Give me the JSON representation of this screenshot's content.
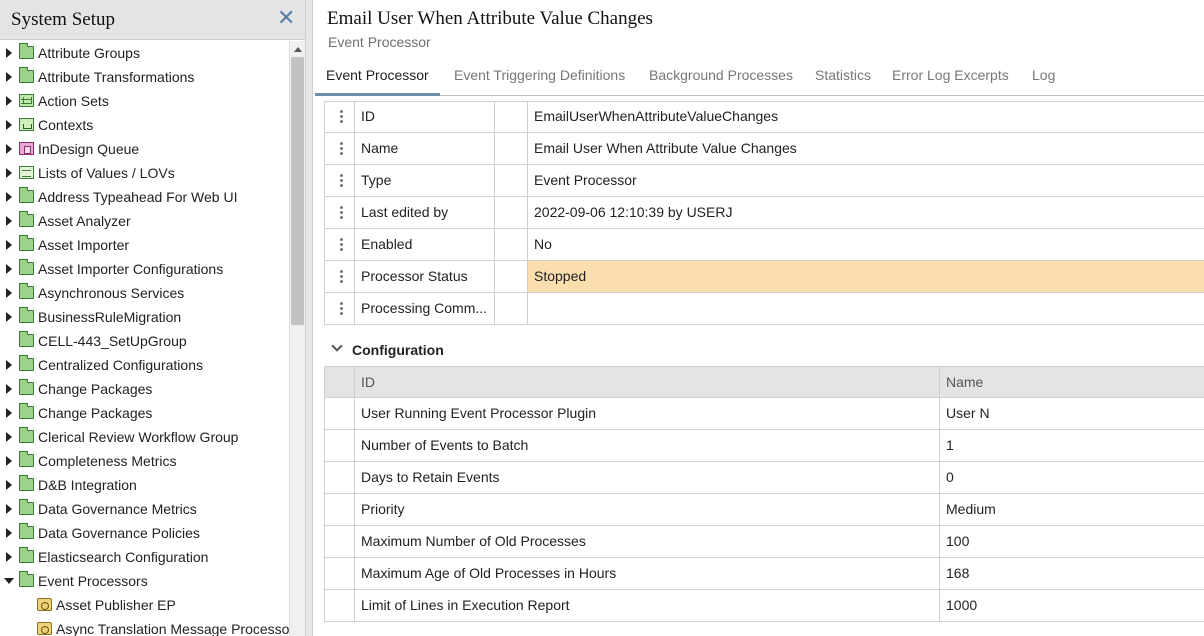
{
  "left_panel": {
    "title": "System Setup",
    "close_symbol": "✕",
    "tree": [
      {
        "label": "Attribute Groups",
        "icon": "folder-icon",
        "arrow": "right",
        "indent": 0
      },
      {
        "label": "Attribute Transformations",
        "icon": "folder-icon",
        "arrow": "right",
        "indent": 0
      },
      {
        "label": "Action Sets",
        "icon": "grid-icon",
        "arrow": "right",
        "indent": 0
      },
      {
        "label": "Contexts",
        "icon": "context-icon",
        "arrow": "right",
        "indent": 0
      },
      {
        "label": "InDesign Queue",
        "icon": "queue-icon",
        "arrow": "right",
        "indent": 0
      },
      {
        "label": "Lists of Values / LOVs",
        "icon": "list-icon",
        "arrow": "right",
        "indent": 0
      },
      {
        "label": "Address Typeahead For Web UI",
        "icon": "folder-icon",
        "arrow": "right",
        "indent": 0
      },
      {
        "label": "Asset Analyzer",
        "icon": "folder-icon",
        "arrow": "right",
        "indent": 0
      },
      {
        "label": "Asset Importer",
        "icon": "folder-icon",
        "arrow": "right",
        "indent": 0
      },
      {
        "label": "Asset Importer Configurations",
        "icon": "folder-icon",
        "arrow": "right",
        "indent": 0
      },
      {
        "label": "Asynchronous Services",
        "icon": "folder-icon",
        "arrow": "right",
        "indent": 0
      },
      {
        "label": "BusinessRuleMigration",
        "icon": "folder-icon",
        "arrow": "right",
        "indent": 0
      },
      {
        "label": "CELL-443_SetUpGroup",
        "icon": "folder-icon",
        "arrow": "none",
        "indent": 0
      },
      {
        "label": "Centralized Configurations",
        "icon": "folder-icon",
        "arrow": "right",
        "indent": 0
      },
      {
        "label": "Change Packages",
        "icon": "folder-icon",
        "arrow": "right",
        "indent": 0
      },
      {
        "label": "Change Packages",
        "icon": "folder-icon",
        "arrow": "right",
        "indent": 0
      },
      {
        "label": "Clerical Review Workflow Group",
        "icon": "folder-icon",
        "arrow": "right",
        "indent": 0
      },
      {
        "label": "Completeness Metrics",
        "icon": "folder-icon",
        "arrow": "right",
        "indent": 0
      },
      {
        "label": "D&B Integration",
        "icon": "folder-icon",
        "arrow": "right",
        "indent": 0
      },
      {
        "label": "Data Governance Metrics",
        "icon": "folder-icon",
        "arrow": "right",
        "indent": 0
      },
      {
        "label": "Data Governance Policies",
        "icon": "folder-icon",
        "arrow": "right",
        "indent": 0
      },
      {
        "label": "Elasticsearch Configuration",
        "icon": "folder-icon",
        "arrow": "right",
        "indent": 0
      },
      {
        "label": "Event Processors",
        "icon": "folder-icon",
        "arrow": "down",
        "indent": 0
      },
      {
        "label": "Asset Publisher EP",
        "icon": "ep-icon",
        "arrow": "none",
        "indent": 1
      },
      {
        "label": "Async Translation Message Processor",
        "icon": "ep-icon",
        "arrow": "none",
        "indent": 1
      }
    ]
  },
  "main": {
    "title": "Email User When Attribute Value Changes",
    "subtitle": "Event Processor",
    "tabs": [
      {
        "label": "Event Processor",
        "active": true
      },
      {
        "label": "Event Triggering Definitions",
        "active": false
      },
      {
        "label": "Background Processes",
        "active": false
      },
      {
        "label": "Statistics",
        "active": false
      },
      {
        "label": "Error Log Excerpts",
        "active": false
      },
      {
        "label": "Log",
        "active": false
      }
    ],
    "properties": [
      {
        "label": "ID",
        "value": "EmailUserWhenAttributeValueChanges",
        "highlight": false
      },
      {
        "label": "Name",
        "value": "Email User When Attribute Value Changes",
        "highlight": false
      },
      {
        "label": "Type",
        "value": "Event Processor",
        "highlight": false
      },
      {
        "label": "Last edited by",
        "value": "2022-09-06 12:10:39 by USERJ",
        "highlight": false
      },
      {
        "label": "Enabled",
        "value": "No",
        "highlight": false
      },
      {
        "label": "Processor Status",
        "value": "Stopped",
        "highlight": true
      },
      {
        "label": "Processing Comm...",
        "value": "",
        "highlight": false
      }
    ],
    "configuration": {
      "title": "Configuration",
      "columns": {
        "id": "ID",
        "name": "Name"
      },
      "rows": [
        {
          "id": "User Running Event Processor Plugin",
          "name": "User N"
        },
        {
          "id": "Number of Events to Batch",
          "name": "1"
        },
        {
          "id": "Days to Retain Events",
          "name": "0"
        },
        {
          "id": "Priority",
          "name": "Medium"
        },
        {
          "id": "Maximum Number of Old Processes",
          "name": "100"
        },
        {
          "id": "Maximum Age of Old Processes in Hours",
          "name": "168"
        },
        {
          "id": "Limit of Lines in Execution Report",
          "name": "1000"
        }
      ]
    }
  },
  "colors": {
    "highlight": "#fbdeae",
    "tab_active_underline": "#6a8fa6",
    "header_background": "#e4e4e4"
  }
}
